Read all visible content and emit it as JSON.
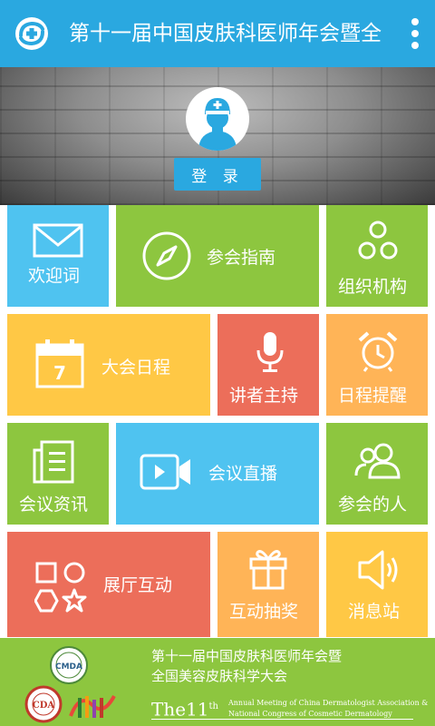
{
  "header": {
    "title": "第十一届中国皮肤科医师年会暨全",
    "logo_icon": "app-logo-icon",
    "menu_icon": "more-vertical-icon"
  },
  "profile": {
    "avatar_icon": "doctor-avatar-icon",
    "login_label": "登 录"
  },
  "tiles": {
    "welcome": {
      "label": "欢迎词",
      "icon": "mail-icon",
      "color": "#4FC3F0"
    },
    "guide": {
      "label": "参会指南",
      "icon": "compass-icon",
      "color": "#8DC63F"
    },
    "organization": {
      "label": "组织机构",
      "icon": "network-icon",
      "color": "#8DC63F"
    },
    "schedule": {
      "label": "大会日程",
      "icon": "calendar-icon",
      "calendar_day": "7",
      "color": "#FFC845"
    },
    "speakers": {
      "label": "讲者主持",
      "icon": "microphone-icon",
      "color": "#EC6E5A"
    },
    "reminder": {
      "label": "日程提醒",
      "icon": "alarm-clock-icon",
      "color": "#FFB457"
    },
    "news": {
      "label": "会议资讯",
      "icon": "document-icon",
      "color": "#8DC63F"
    },
    "live": {
      "label": "会议直播",
      "icon": "video-camera-icon",
      "color": "#4FC3F0"
    },
    "attendees": {
      "label": "参会的人",
      "icon": "people-icon",
      "color": "#8DC63F"
    },
    "exhibition": {
      "label": "展厅互动",
      "icon": "shapes-icon",
      "color": "#EC6E5A"
    },
    "lottery": {
      "label": "互动抽奖",
      "icon": "gift-icon",
      "color": "#FFB457"
    },
    "messages": {
      "label": "消息站",
      "icon": "speaker-icon",
      "color": "#FFC845"
    }
  },
  "footer": {
    "title_line1": "第十一届中国皮肤科医师年会暨",
    "title_line2": "全国美容皮肤科学大会",
    "the_prefix": "The",
    "edition": "11",
    "edition_suffix": "th",
    "english_line1": "Annual Meeting of China Dermatologist Association &",
    "english_line2": "National Congress of Cosmetic Dermatology",
    "logo_cmda": "CMDA",
    "logo_cda": "CDA"
  }
}
